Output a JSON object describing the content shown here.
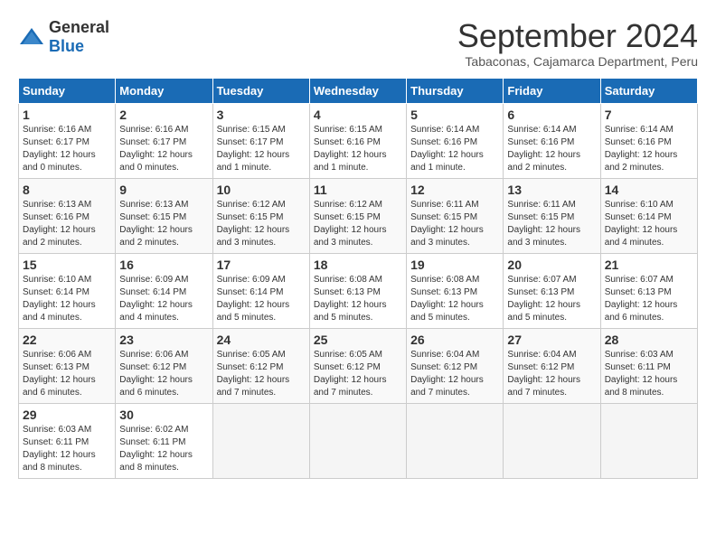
{
  "header": {
    "logo_general": "General",
    "logo_blue": "Blue",
    "title": "September 2024",
    "subtitle": "Tabaconas, Cajamarca Department, Peru"
  },
  "calendar": {
    "weekdays": [
      "Sunday",
      "Monday",
      "Tuesday",
      "Wednesday",
      "Thursday",
      "Friday",
      "Saturday"
    ],
    "weeks": [
      [
        {
          "day": "1",
          "sunrise": "6:16 AM",
          "sunset": "6:17 PM",
          "daylight": "12 hours and 0 minutes."
        },
        {
          "day": "2",
          "sunrise": "6:16 AM",
          "sunset": "6:17 PM",
          "daylight": "12 hours and 0 minutes."
        },
        {
          "day": "3",
          "sunrise": "6:15 AM",
          "sunset": "6:17 PM",
          "daylight": "12 hours and 1 minute."
        },
        {
          "day": "4",
          "sunrise": "6:15 AM",
          "sunset": "6:16 PM",
          "daylight": "12 hours and 1 minute."
        },
        {
          "day": "5",
          "sunrise": "6:14 AM",
          "sunset": "6:16 PM",
          "daylight": "12 hours and 1 minute."
        },
        {
          "day": "6",
          "sunrise": "6:14 AM",
          "sunset": "6:16 PM",
          "daylight": "12 hours and 2 minutes."
        },
        {
          "day": "7",
          "sunrise": "6:14 AM",
          "sunset": "6:16 PM",
          "daylight": "12 hours and 2 minutes."
        }
      ],
      [
        {
          "day": "8",
          "sunrise": "6:13 AM",
          "sunset": "6:16 PM",
          "daylight": "12 hours and 2 minutes."
        },
        {
          "day": "9",
          "sunrise": "6:13 AM",
          "sunset": "6:15 PM",
          "daylight": "12 hours and 2 minutes."
        },
        {
          "day": "10",
          "sunrise": "6:12 AM",
          "sunset": "6:15 PM",
          "daylight": "12 hours and 3 minutes."
        },
        {
          "day": "11",
          "sunrise": "6:12 AM",
          "sunset": "6:15 PM",
          "daylight": "12 hours and 3 minutes."
        },
        {
          "day": "12",
          "sunrise": "6:11 AM",
          "sunset": "6:15 PM",
          "daylight": "12 hours and 3 minutes."
        },
        {
          "day": "13",
          "sunrise": "6:11 AM",
          "sunset": "6:15 PM",
          "daylight": "12 hours and 3 minutes."
        },
        {
          "day": "14",
          "sunrise": "6:10 AM",
          "sunset": "6:14 PM",
          "daylight": "12 hours and 4 minutes."
        }
      ],
      [
        {
          "day": "15",
          "sunrise": "6:10 AM",
          "sunset": "6:14 PM",
          "daylight": "12 hours and 4 minutes."
        },
        {
          "day": "16",
          "sunrise": "6:09 AM",
          "sunset": "6:14 PM",
          "daylight": "12 hours and 4 minutes."
        },
        {
          "day": "17",
          "sunrise": "6:09 AM",
          "sunset": "6:14 PM",
          "daylight": "12 hours and 5 minutes."
        },
        {
          "day": "18",
          "sunrise": "6:08 AM",
          "sunset": "6:13 PM",
          "daylight": "12 hours and 5 minutes."
        },
        {
          "day": "19",
          "sunrise": "6:08 AM",
          "sunset": "6:13 PM",
          "daylight": "12 hours and 5 minutes."
        },
        {
          "day": "20",
          "sunrise": "6:07 AM",
          "sunset": "6:13 PM",
          "daylight": "12 hours and 5 minutes."
        },
        {
          "day": "21",
          "sunrise": "6:07 AM",
          "sunset": "6:13 PM",
          "daylight": "12 hours and 6 minutes."
        }
      ],
      [
        {
          "day": "22",
          "sunrise": "6:06 AM",
          "sunset": "6:13 PM",
          "daylight": "12 hours and 6 minutes."
        },
        {
          "day": "23",
          "sunrise": "6:06 AM",
          "sunset": "6:12 PM",
          "daylight": "12 hours and 6 minutes."
        },
        {
          "day": "24",
          "sunrise": "6:05 AM",
          "sunset": "6:12 PM",
          "daylight": "12 hours and 7 minutes."
        },
        {
          "day": "25",
          "sunrise": "6:05 AM",
          "sunset": "6:12 PM",
          "daylight": "12 hours and 7 minutes."
        },
        {
          "day": "26",
          "sunrise": "6:04 AM",
          "sunset": "6:12 PM",
          "daylight": "12 hours and 7 minutes."
        },
        {
          "day": "27",
          "sunrise": "6:04 AM",
          "sunset": "6:12 PM",
          "daylight": "12 hours and 7 minutes."
        },
        {
          "day": "28",
          "sunrise": "6:03 AM",
          "sunset": "6:11 PM",
          "daylight": "12 hours and 8 minutes."
        }
      ],
      [
        {
          "day": "29",
          "sunrise": "6:03 AM",
          "sunset": "6:11 PM",
          "daylight": "12 hours and 8 minutes."
        },
        {
          "day": "30",
          "sunrise": "6:02 AM",
          "sunset": "6:11 PM",
          "daylight": "12 hours and 8 minutes."
        },
        null,
        null,
        null,
        null,
        null
      ]
    ]
  }
}
